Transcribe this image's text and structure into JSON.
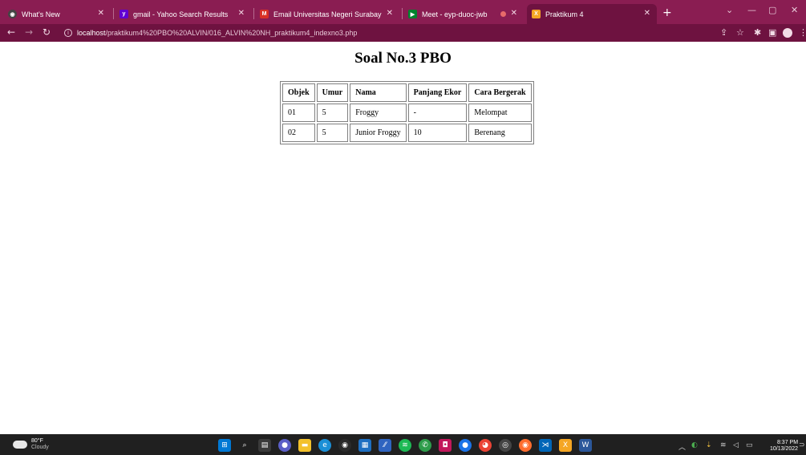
{
  "browser": {
    "tabs": [
      {
        "title": "What's New",
        "active": false
      },
      {
        "title": "gmail - Yahoo Search Results",
        "active": false
      },
      {
        "title": "Email Universitas Negeri Surabay",
        "active": false
      },
      {
        "title": "Meet - eyp-duoc-jwb",
        "active": false
      },
      {
        "title": "Praktikum 4",
        "active": true
      }
    ],
    "url_host": "localhost",
    "url_path": "/praktikum4%20PBO%20ALVIN/016_ALVIN%20NH_praktikum4_indexno3.php"
  },
  "page": {
    "title": "Soal No.3 PBO",
    "table": {
      "headers": [
        "Objek",
        "Umur",
        "Nama",
        "Panjang Ekor",
        "Cara Bergerak"
      ],
      "rows": [
        [
          "01",
          "5",
          "Froggy",
          "-",
          "Melompat"
        ],
        [
          "02",
          "5",
          "Junior Froggy",
          "10",
          "Berenang"
        ]
      ]
    }
  },
  "taskbar": {
    "weather_temp": "80°F",
    "weather_desc": "Cloudy",
    "time": "8:37 PM",
    "date": "10/13/2022"
  },
  "colors": {
    "tabstrip": "#8a1d52",
    "toolbar": "#6e1240",
    "taskbar": "#202020"
  }
}
